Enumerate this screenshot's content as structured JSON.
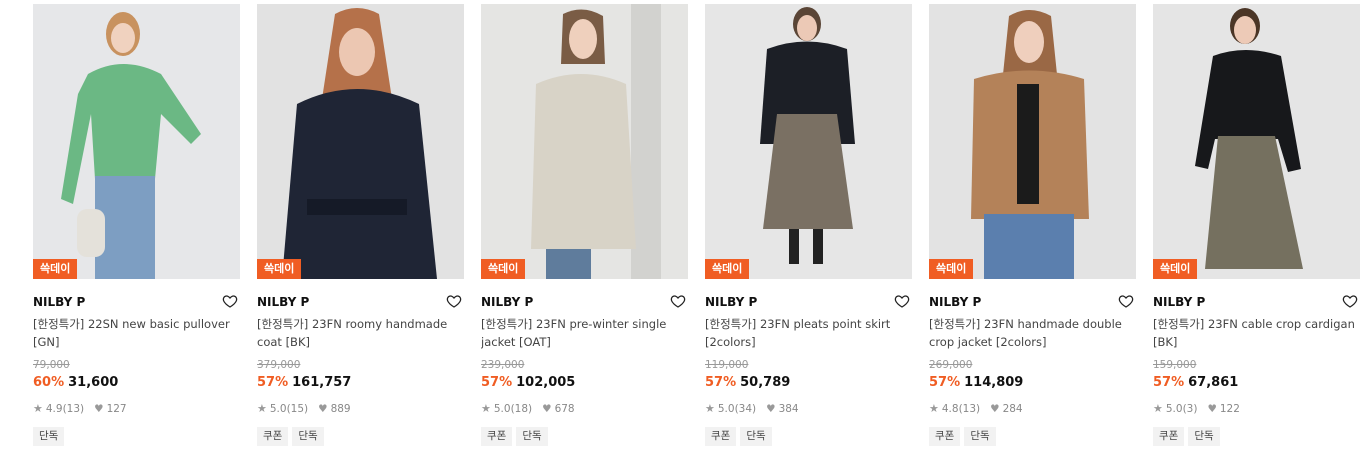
{
  "colors": {
    "accent": "#f05d23",
    "badge_bg": "#f05d23",
    "muted": "#999999"
  },
  "products": [
    {
      "badge": "쓱데이",
      "brand": "NILBY P",
      "name": "[한정특가] 22SN new basic pullover [GN]",
      "original_price": "79,000",
      "discount": "60%",
      "price": "31,600",
      "rating": "4.9",
      "reviews": "(13)",
      "likes": "127",
      "tags": [
        "단독"
      ]
    },
    {
      "badge": "쓱데이",
      "brand": "NILBY P",
      "name": "[한정특가] 23FN roomy handmade coat [BK]",
      "original_price": "379,000",
      "discount": "57%",
      "price": "161,757",
      "rating": "5.0",
      "reviews": "(15)",
      "likes": "889",
      "tags": [
        "쿠폰",
        "단독"
      ]
    },
    {
      "badge": "쓱데이",
      "brand": "NILBY P",
      "name": "[한정특가] 23FN pre-winter single jacket [OAT]",
      "original_price": "239,000",
      "discount": "57%",
      "price": "102,005",
      "rating": "5.0",
      "reviews": "(18)",
      "likes": "678",
      "tags": [
        "쿠폰",
        "단독"
      ]
    },
    {
      "badge": "쓱데이",
      "brand": "NILBY P",
      "name": "[한정특가] 23FN pleats point skirt [2colors]",
      "original_price": "119,000",
      "discount": "57%",
      "price": "50,789",
      "rating": "5.0",
      "reviews": "(34)",
      "likes": "384",
      "tags": [
        "쿠폰",
        "단독"
      ]
    },
    {
      "badge": "쓱데이",
      "brand": "NILBY P",
      "name": "[한정특가] 23FN handmade double crop jacket [2colors]",
      "original_price": "269,000",
      "discount": "57%",
      "price": "114,809",
      "rating": "4.8",
      "reviews": "(13)",
      "likes": "284",
      "tags": [
        "쿠폰",
        "단독"
      ]
    },
    {
      "badge": "쓱데이",
      "brand": "NILBY P",
      "name": "[한정특가] 23FN cable crop cardigan [BK]",
      "original_price": "159,000",
      "discount": "57%",
      "price": "67,861",
      "rating": "5.0",
      "reviews": "(3)",
      "likes": "122",
      "tags": [
        "쿠폰",
        "단독"
      ]
    }
  ]
}
